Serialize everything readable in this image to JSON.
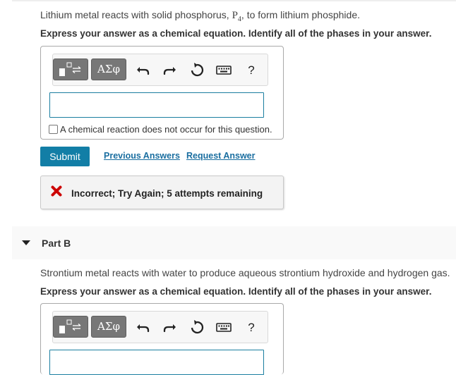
{
  "part_a": {
    "question_prefix": "Lithium metal reacts with solid phosphorus, ",
    "formula_base": "P",
    "formula_sub": "4",
    "question_suffix": ", to form lithium phosphide.",
    "instruction": "Express your answer as a chemical equation. Identify all of the phases in your answer.",
    "toolbar": {
      "templates_icon": "templates-icon",
      "greek_label": "ΑΣφ",
      "undo_icon": "undo-icon",
      "redo_icon": "redo-icon",
      "reset_icon": "reset-icon",
      "keyboard_icon": "keyboard-icon",
      "help_label": "?"
    },
    "answer_value": "",
    "no_reaction_label": "A chemical reaction does not occur for this question.",
    "submit_label": "Submit",
    "previous_answers_label": "Previous Answers",
    "request_answer_label": "Request Answer",
    "feedback": "Incorrect; Try Again; 5 attempts remaining",
    "feedback_color": "#cc0000"
  },
  "part_b": {
    "header_label": "Part B",
    "question": "Strontium metal reacts with water to produce aqueous strontium hydroxide and hydrogen gas.",
    "instruction": "Express your answer as a chemical equation. Identify all of the phases in your answer.",
    "toolbar": {
      "greek_label": "ΑΣφ",
      "help_label": "?"
    }
  },
  "colors": {
    "accent": "#127ea6",
    "link": "#1a6ea0",
    "toolbar_button": "#777777"
  }
}
